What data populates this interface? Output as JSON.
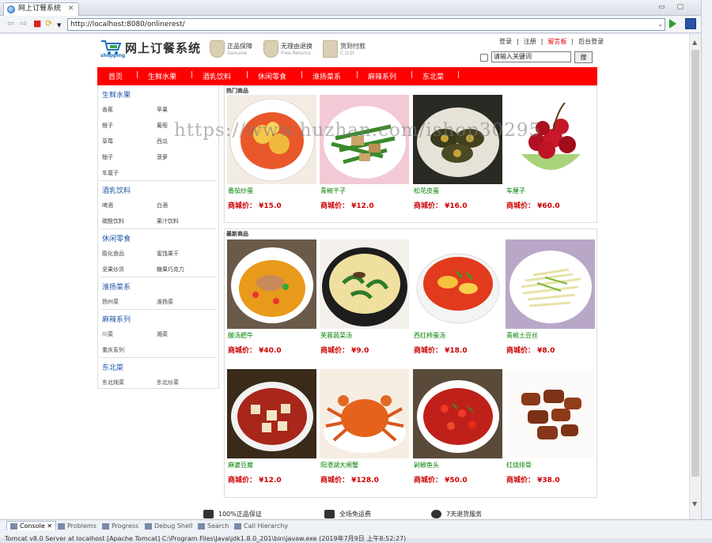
{
  "ide": {
    "tab_title": "网上订餐系统",
    "tab_close": "✕",
    "url": "http://localhost:8080/onlinerest/"
  },
  "site": {
    "logo_title": "网上订餐系统",
    "logo_sub": "shopping",
    "badges": [
      {
        "title": "正品保障",
        "sub": "Genuine"
      },
      {
        "title": "无理由退换",
        "sub": "Free Returns"
      },
      {
        "title": "货到付款",
        "sub": "C.O.D"
      }
    ],
    "top_links": [
      "登录",
      "|",
      "注册",
      "|",
      "留言板",
      "|",
      "后台登录"
    ],
    "search_value": "请输入关键词",
    "search_button": "搜"
  },
  "nav": [
    "首页",
    "生鲜水果",
    "酒乳饮料",
    "休闲零食",
    "淮扬菜系",
    "麻辣系列",
    "东北菜"
  ],
  "sidebar": [
    {
      "title": "生鲜水果",
      "items": [
        "香蕉",
        "苹果",
        "橙子",
        "葡萄",
        "草莓",
        "西瓜",
        "柚子",
        "菠萝",
        "车厘子"
      ]
    },
    {
      "title": "酒乳饮料",
      "items": [
        "啤酒",
        "白酒",
        "碳酸饮料",
        "果汁饮料"
      ]
    },
    {
      "title": "休闲零食",
      "items": [
        "膨化食品",
        "蜜饯果干",
        "坚果炒货",
        "糖果巧克力"
      ]
    },
    {
      "title": "淮扬菜系",
      "items": [
        "扬州菜",
        "淮扬菜"
      ]
    },
    {
      "title": "麻辣系列",
      "items": [
        "川菜",
        "湘菜",
        "重庆系列"
      ]
    },
    {
      "title": "东北菜",
      "items": [
        "东北炖菜",
        "东北炒菜"
      ]
    }
  ],
  "hot": {
    "title": "热门商品",
    "products": [
      {
        "name": "番茄炒蛋",
        "price": "商城价： ¥15.0",
        "img": "tomato-egg"
      },
      {
        "name": "青椒干子",
        "price": "商城价： ¥12.0",
        "img": "pepper-tofu"
      },
      {
        "name": "松花皮蛋",
        "price": "商城价： ¥16.0",
        "img": "century-egg"
      },
      {
        "name": "车厘子",
        "price": "商城价： ¥60.0",
        "img": "cherries"
      }
    ]
  },
  "latest": {
    "title": "最新商品",
    "products": [
      {
        "name": "酸汤肥牛",
        "price": "商城价： ¥40.0",
        "img": "sour-beef"
      },
      {
        "name": "芙蓉蔬菜汤",
        "price": "商城价： ¥9.0",
        "img": "veg-soup"
      },
      {
        "name": "西红柿蛋汤",
        "price": "商城价： ¥18.0",
        "img": "tomato-soup"
      },
      {
        "name": "青椒土豆丝",
        "price": "商城价： ¥8.0",
        "img": "potato-strips"
      },
      {
        "name": "麻婆豆腐",
        "price": "商城价： ¥12.0",
        "img": "mapo-tofu"
      },
      {
        "name": "阳澄湖大闸蟹",
        "price": "商城价： ¥128.0",
        "img": "hairy-crab"
      },
      {
        "name": "剁椒鱼头",
        "price": "商城价： ¥50.0",
        "img": "fish-head"
      },
      {
        "name": "红烧排骨",
        "price": "商城价： ¥38.0",
        "img": "braised-ribs"
      }
    ]
  },
  "watermark": "https://www.huzhan.com/ishop30295",
  "features": [
    "100%正品保证",
    "全场免运费",
    "7天退货服务"
  ],
  "console": {
    "tabs": [
      "Console",
      "Problems",
      "Progress",
      "Debug Shell",
      "Search",
      "Call Hierarchy"
    ],
    "status": "Tomcat v8.0 Server at localhost [Apache Tomcat] C:\\Program Files\\Java\\jdk1.8.0_201\\bin\\javaw.exe (2019年7月9日 上午8:52:27)"
  }
}
